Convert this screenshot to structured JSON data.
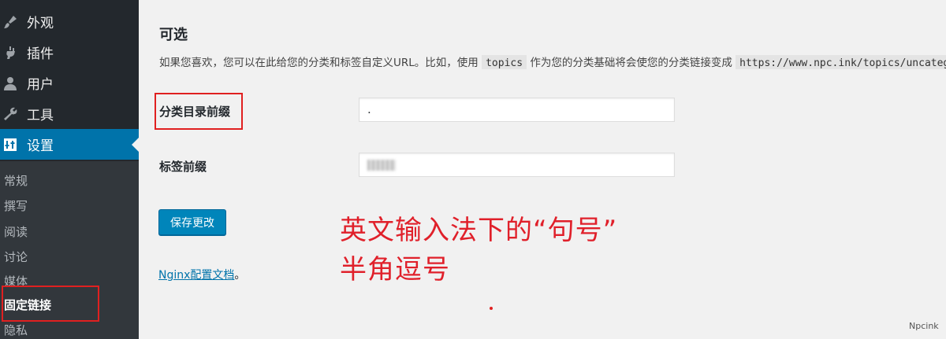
{
  "sidebar": {
    "menu": [
      {
        "label": "外观",
        "icon": "paintbrush-icon"
      },
      {
        "label": "插件",
        "icon": "plugin-icon"
      },
      {
        "label": "用户",
        "icon": "user-icon"
      },
      {
        "label": "工具",
        "icon": "wrench-icon"
      },
      {
        "label": "设置",
        "icon": "settings-icon",
        "active": true
      }
    ],
    "submenu": [
      "常规",
      "撰写",
      "阅读",
      "讨论",
      "媒体",
      "固定链接",
      "隐私"
    ],
    "current_submenu": "固定链接"
  },
  "main": {
    "section_title": "可选",
    "description": {
      "part1": "如果您喜欢，您可以在此给您的分类和标签自定义URL。比如，使用",
      "code1": "topics",
      "part2": "作为您的分类基础将会使您的分类链接变成",
      "code2": "https://www.npc.ink/topics/uncategorized/"
    },
    "category_base": {
      "label": "分类目录前缀",
      "value": "."
    },
    "tag_base": {
      "label": "标签前缀"
    },
    "save_button": "保存更改",
    "nginx_link": "Nginx配置文档",
    "nginx_suffix": "。"
  },
  "annotation": {
    "line1": "英文输入法下的“句号”",
    "line2": "半角逗号",
    "color": "#e0202a"
  },
  "watermark": "Npcink",
  "colors": {
    "sidebar": "#23282d",
    "submenu": "#32373c",
    "active": "#0073aa",
    "button": "#0085ba",
    "highlight": "#e02020"
  }
}
